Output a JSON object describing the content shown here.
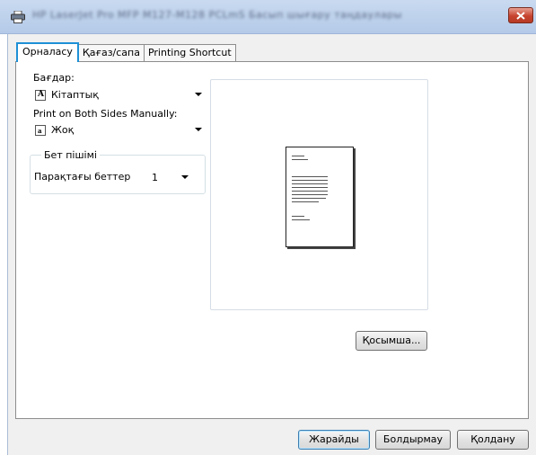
{
  "window": {
    "title": "HP LaserJet Pro MFP M127-M128 PCLmS Басып шығару таңдаулары"
  },
  "tabs": [
    {
      "label": "Орналасу"
    },
    {
      "label": "Қағаз/сапа"
    },
    {
      "label": "Printing Shortcut"
    }
  ],
  "layout": {
    "orientation_label": "Бағдар:",
    "orientation_value": "Кітаптық",
    "duplex_label": "Print on Both Sides Manually:",
    "duplex_value": "Жоқ",
    "page_format_group": "Бет пішімі",
    "pages_per_sheet_label": "Парақтағы беттер",
    "pages_per_sheet_value": "1"
  },
  "buttons": {
    "advanced": "Қосымша...",
    "ok": "Жарайды",
    "cancel": "Болдырмау",
    "apply": "Қолдану"
  },
  "colors": {
    "active_tab_border": "#1e90d6",
    "close_button": "#c7432f"
  },
  "icons": {
    "window": "printer-icon",
    "close": "close-icon",
    "orientation": "portrait-icon",
    "duplex": "single-side-icon"
  }
}
